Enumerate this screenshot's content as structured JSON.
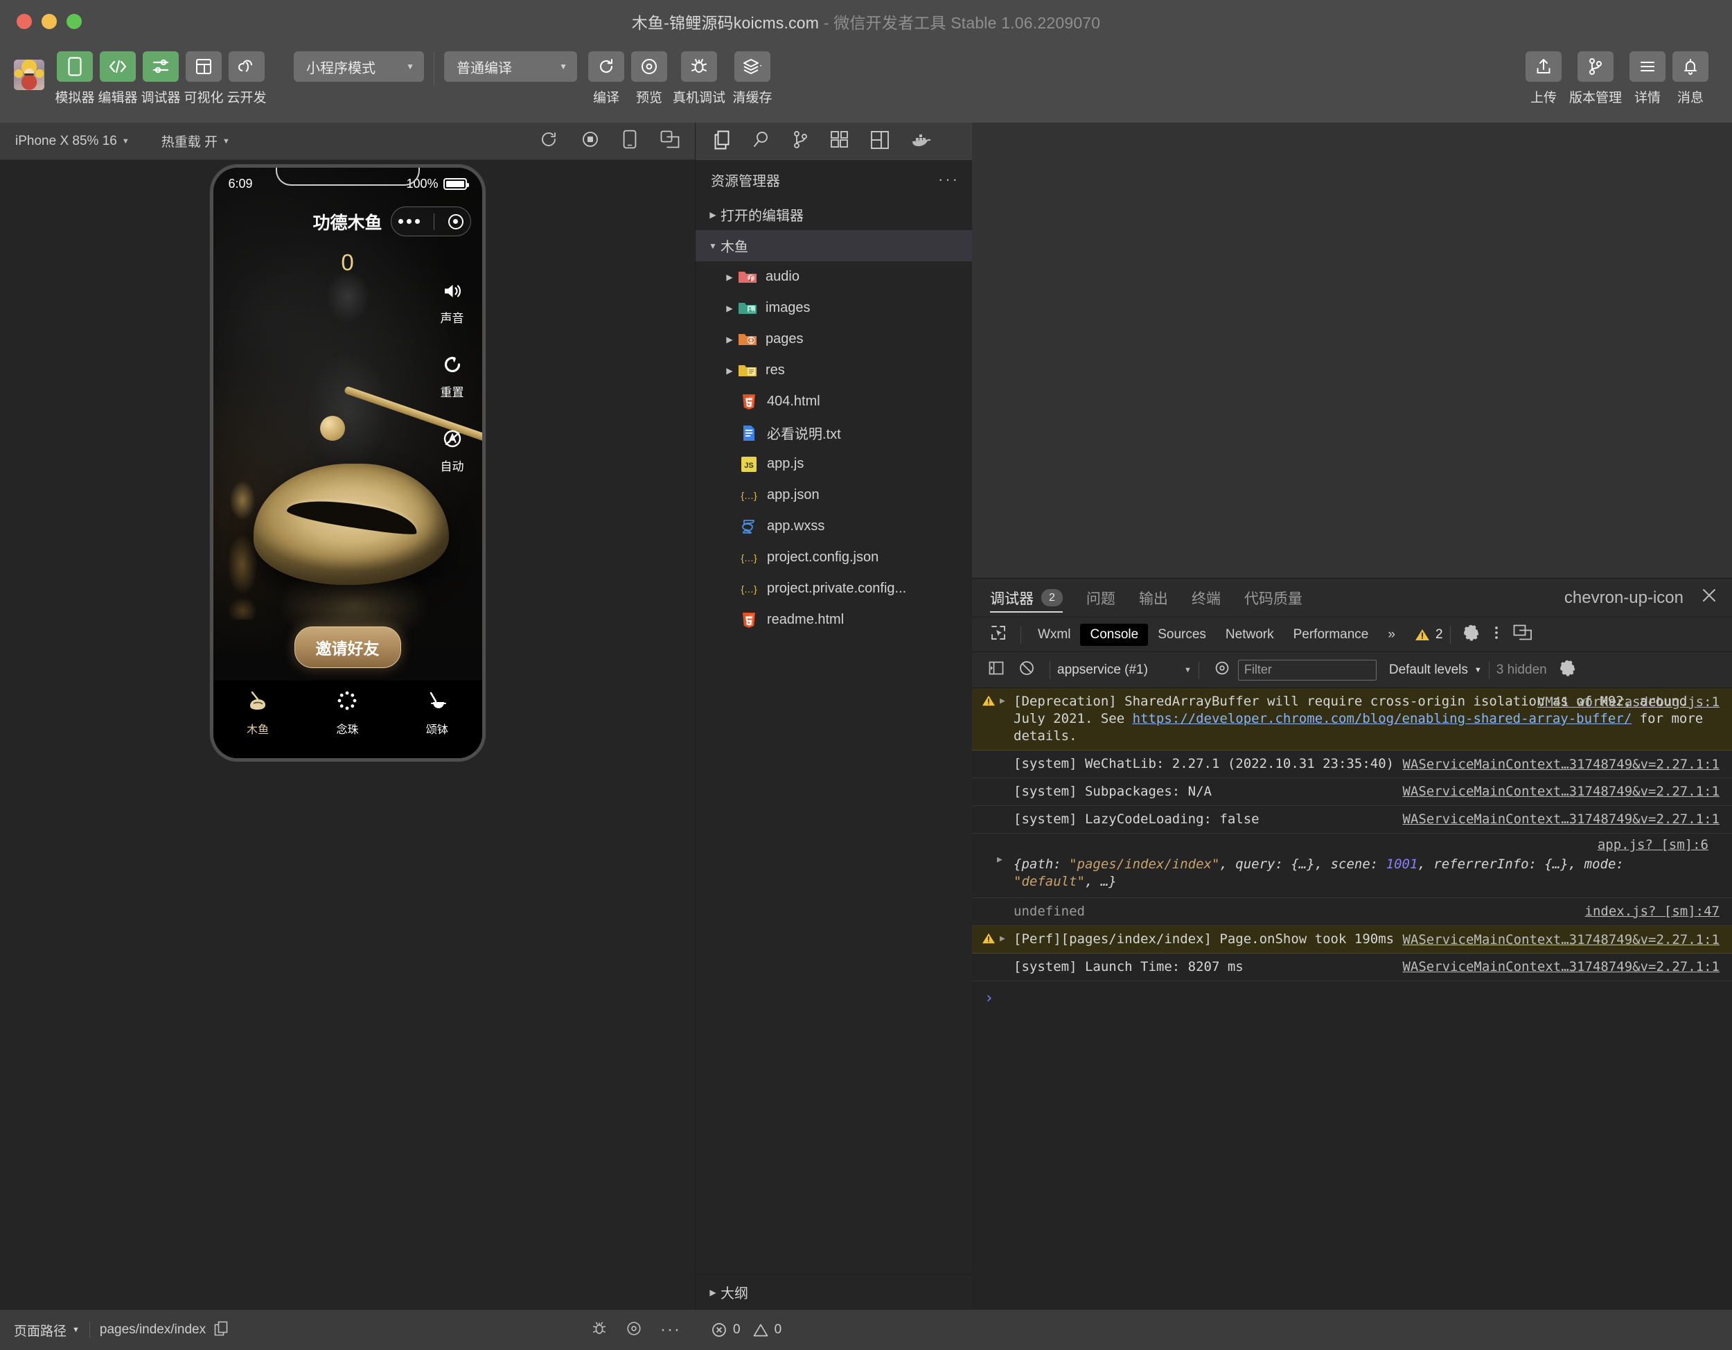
{
  "window": {
    "title_main": "木鱼-锦鲤源码koicms.com",
    "title_sep": " - ",
    "title_sub": "微信开发者工具 Stable 1.06.2209070"
  },
  "toolbar": {
    "buttons": [
      {
        "label": "模拟器",
        "icon": "phone-icon",
        "active": true
      },
      {
        "label": "编辑器",
        "icon": "code-icon",
        "active": true
      },
      {
        "label": "调试器",
        "icon": "sliders-icon",
        "active": true
      },
      {
        "label": "可视化",
        "icon": "layout-icon",
        "active": false
      },
      {
        "label": "云开发",
        "icon": "cloud-icon",
        "active": false
      }
    ],
    "mode_select": "小程序模式",
    "compile_select": "普通编译",
    "actions": [
      {
        "label": "编译",
        "icon": "refresh-icon"
      },
      {
        "label": "预览",
        "icon": "eye-target-icon"
      },
      {
        "label": "真机调试",
        "icon": "bug-icon"
      },
      {
        "label": "清缓存",
        "icon": "layers-icon"
      }
    ],
    "right_actions": [
      {
        "label": "上传",
        "icon": "upload-icon"
      },
      {
        "label": "版本管理",
        "icon": "git-branch-icon"
      },
      {
        "label": "详情",
        "icon": "menu-lines-icon"
      },
      {
        "label": "消息",
        "icon": "bell-icon"
      }
    ]
  },
  "simulator": {
    "device": "iPhone X 85% 16",
    "hotreload": "热重载 开",
    "icons": [
      "refresh-icon",
      "record-icon",
      "device-icon",
      "multi-window-icon"
    ],
    "phone": {
      "status_time": "6:09",
      "battery_percent": "100%",
      "nav_title": "功德木鱼",
      "counter": "0",
      "side_actions": [
        {
          "label": "声音",
          "icon": "speaker-icon"
        },
        {
          "label": "重置",
          "icon": "reset-icon"
        },
        {
          "label": "自动",
          "icon": "auto-icon"
        }
      ],
      "invite_button": "邀请好友",
      "tabs": [
        {
          "label": "木鱼",
          "icon": "wooden-fish-icon",
          "active": true
        },
        {
          "label": "念珠",
          "icon": "prayer-beads-icon",
          "active": false
        },
        {
          "label": "颂钵",
          "icon": "singing-bowl-icon",
          "active": false
        }
      ]
    }
  },
  "explorer": {
    "activity_icons": [
      "files-icon",
      "search-icon",
      "git-branch-icon",
      "extensions-icon",
      "snippet-icon",
      "docker-icon"
    ],
    "header": "资源管理器",
    "header_menu": "···",
    "sections": [
      {
        "label": "打开的编辑器",
        "expanded": false,
        "type": "section"
      },
      {
        "label": "木鱼",
        "expanded": true,
        "type": "section",
        "selected": true
      }
    ],
    "files": [
      {
        "name": "audio",
        "type": "folder",
        "icon": "folder-audio-icon",
        "expanded": false
      },
      {
        "name": "images",
        "type": "folder",
        "icon": "folder-images-icon",
        "expanded": false
      },
      {
        "name": "pages",
        "type": "folder",
        "icon": "folder-code-icon",
        "expanded": false
      },
      {
        "name": "res",
        "type": "folder",
        "icon": "folder-res-icon",
        "expanded": false
      },
      {
        "name": "404.html",
        "type": "file",
        "icon": "html5-icon"
      },
      {
        "name": "必看说明.txt",
        "type": "file",
        "icon": "text-file-icon"
      },
      {
        "name": "app.js",
        "type": "file",
        "icon": "js-icon"
      },
      {
        "name": "app.json",
        "type": "file",
        "icon": "json-icon"
      },
      {
        "name": "app.wxss",
        "type": "file",
        "icon": "wxss-icon"
      },
      {
        "name": "project.config.json",
        "type": "file",
        "icon": "json-icon"
      },
      {
        "name": "project.private.config...",
        "type": "file",
        "icon": "json-icon"
      },
      {
        "name": "readme.html",
        "type": "file",
        "icon": "html5-icon"
      }
    ],
    "outline": "大纲"
  },
  "devtools": {
    "panel_tabs": [
      {
        "label": "调试器",
        "badge": "2",
        "active": true
      },
      {
        "label": "问题",
        "badge": "",
        "active": false
      },
      {
        "label": "输出",
        "badge": "",
        "active": false
      },
      {
        "label": "终端",
        "badge": "",
        "active": false
      },
      {
        "label": "代码质量",
        "badge": "",
        "active": false
      }
    ],
    "collapse_icon": "chevron-up-icon",
    "close_icon": "close-icon",
    "inspector_tabs": [
      {
        "label": "Wxml",
        "active": false
      },
      {
        "label": "Console",
        "active": true
      },
      {
        "label": "Sources",
        "active": false
      },
      {
        "label": "Network",
        "active": false
      },
      {
        "label": "Performance",
        "active": false
      }
    ],
    "more_tabs": "»",
    "warning_count": "2",
    "console_bar": {
      "context": "appservice (#1)",
      "filter_placeholder": "Filter",
      "levels": "Default levels",
      "hidden": "3 hidden"
    },
    "messages": [
      {
        "level": "warning",
        "expandable": true,
        "parts": [
          {
            "t": "[Deprecation] SharedArrayBuffer will require cross-origin isolation as of M92, around July 2021. See ",
            "k": "plain"
          },
          {
            "t": "https://developer.chrome.com/blog/enabling-shared-array-buffer/",
            "k": "link"
          },
          {
            "t": " for more details.",
            "k": "plain"
          }
        ],
        "source": "VM41 workerasdebug.js:1"
      },
      {
        "level": "info",
        "expandable": false,
        "parts": [
          {
            "t": "[system] WeChatLib: 2.27.1 (2022.10.31 23:35:40)",
            "k": "plain"
          }
        ],
        "source": "WAServiceMainContext…31748749&v=2.27.1:1"
      },
      {
        "level": "info",
        "expandable": false,
        "parts": [
          {
            "t": "[system] Subpackages: N/A",
            "k": "plain"
          }
        ],
        "source": "WAServiceMainContext…31748749&v=2.27.1:1"
      },
      {
        "level": "info",
        "expandable": false,
        "parts": [
          {
            "t": "[system] LazyCodeLoading: false",
            "k": "plain"
          }
        ],
        "source": "WAServiceMainContext…31748749&v=2.27.1:1"
      },
      {
        "level": "object",
        "expandable": true,
        "parts": [
          {
            "t": "{path: ",
            "k": "ital"
          },
          {
            "t": "\"pages/index/index\"",
            "k": "str"
          },
          {
            "t": ", query: {…}, scene: ",
            "k": "ital"
          },
          {
            "t": "1001",
            "k": "num"
          },
          {
            "t": ", referrerInfo: {…}, mode: ",
            "k": "ital"
          },
          {
            "t": "\"default\"",
            "k": "str"
          },
          {
            "t": ", …}",
            "k": "ital"
          }
        ],
        "source": "app.js? [sm]:6"
      },
      {
        "level": "undefined",
        "expandable": false,
        "parts": [
          {
            "t": "undefined",
            "k": "dim"
          }
        ],
        "source": "index.js? [sm]:47"
      },
      {
        "level": "warning",
        "expandable": true,
        "parts": [
          {
            "t": "[Perf][pages/index/index] Page.onShow took 190ms",
            "k": "plain"
          }
        ],
        "source": "WAServiceMainContext…31748749&v=2.27.1:1"
      },
      {
        "level": "info",
        "expandable": false,
        "parts": [
          {
            "t": "[system] Launch Time: 8207 ms",
            "k": "plain"
          }
        ],
        "source": "WAServiceMainContext…31748749&v=2.27.1:1"
      }
    ],
    "prompt": "›"
  },
  "statusbar": {
    "page_path_label": "页面路径",
    "page_path": "pages/index/index",
    "copy_icon": "copy-icon",
    "icons": [
      "bug-icon",
      "eye-target-icon",
      "more-icon"
    ],
    "errors": "0",
    "warnings": "0"
  },
  "colors": {
    "accent_green": "#64a96a",
    "warn_yellow": "#f0c040",
    "link_blue": "#8ab4f8",
    "gold": "#e8d08a"
  }
}
